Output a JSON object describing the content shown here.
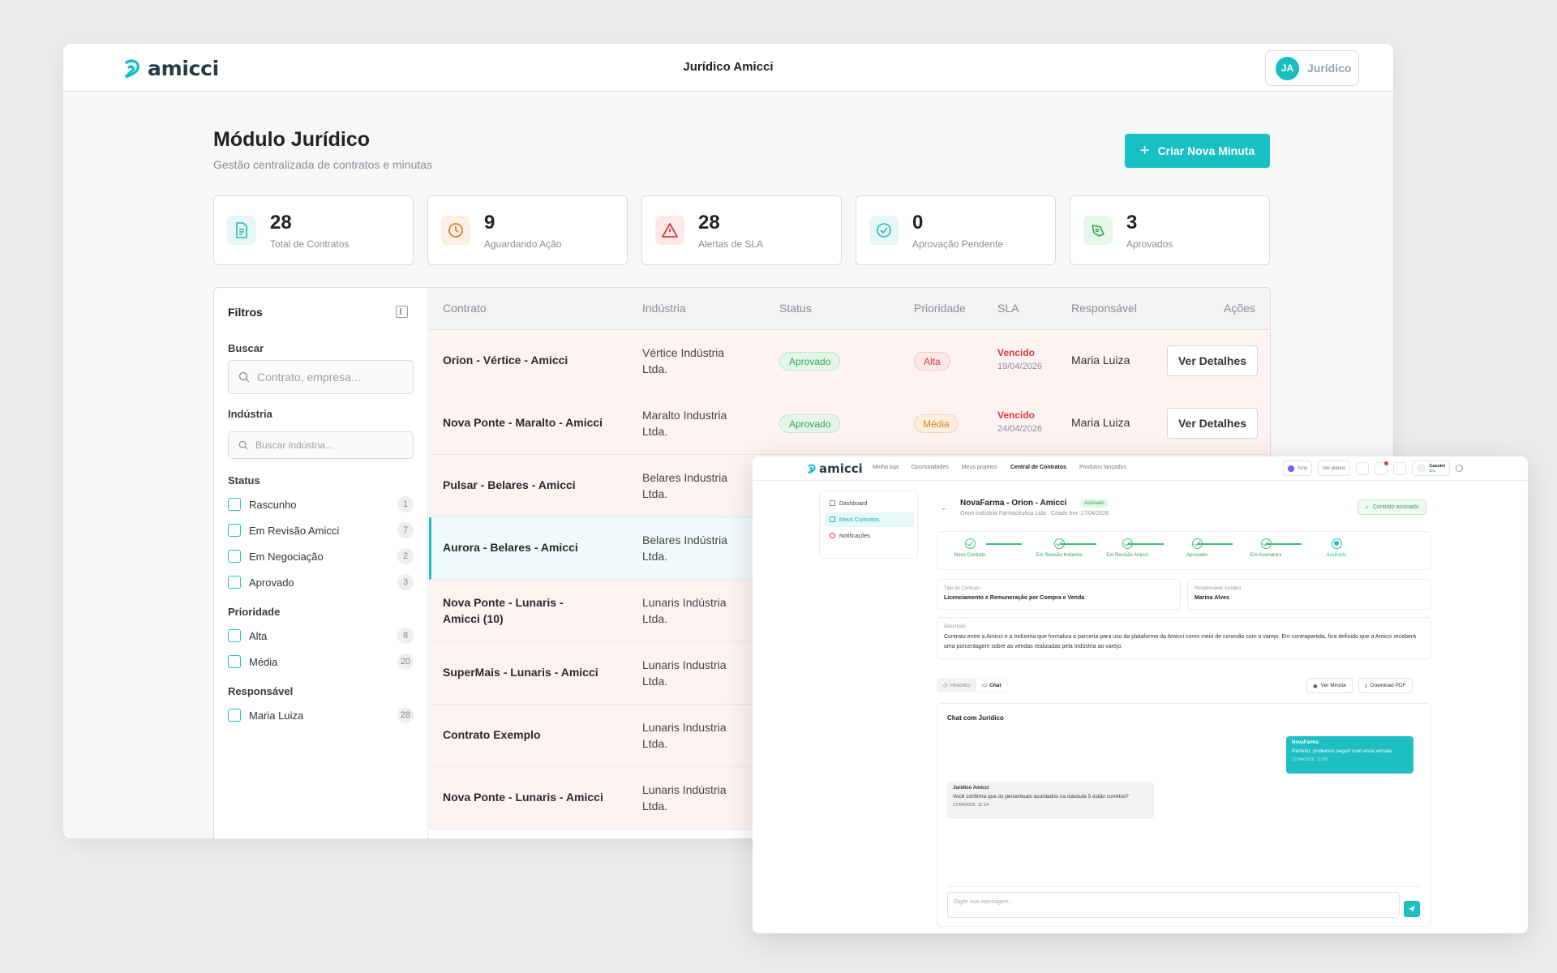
{
  "app": {
    "logo_text": "amicci",
    "window_title": "Jurídico Amicci",
    "user_initials": "JA",
    "user_name": "Jurídico",
    "accent": "#17c0c3"
  },
  "page": {
    "title": "Módulo Jurídico",
    "subtitle": "Gestão centralizada de contratos e minutas",
    "new_button": "Criar Nova Minuta"
  },
  "stats": [
    {
      "value": "28",
      "label": "Total de Contratos",
      "icon": "document-icon"
    },
    {
      "value": "9",
      "label": "Aguardando Ação",
      "icon": "clock-icon"
    },
    {
      "value": "28",
      "label": "Alertas de SLA",
      "icon": "warning-icon"
    },
    {
      "value": "0",
      "label": "Aprovação Pendente",
      "icon": "check-circle-icon"
    },
    {
      "value": "3",
      "label": "Aprovados",
      "icon": "pen-icon"
    }
  ],
  "filters": {
    "title": "Filtros",
    "search_label": "Buscar",
    "search_placeholder": "Contrato, empresa...",
    "industry_label": "Indústria",
    "industry_placeholder": "Buscar indústria...",
    "status_label": "Status",
    "status_items": [
      {
        "label": "Rascunho",
        "count": "1"
      },
      {
        "label": "Em Revisão Amicci",
        "count": "7"
      },
      {
        "label": "Em Negociação",
        "count": "2"
      },
      {
        "label": "Aprovado",
        "count": "3"
      }
    ],
    "priority_label": "Prioridade",
    "priority_items": [
      {
        "label": "Alta",
        "count": "8"
      },
      {
        "label": "Média",
        "count": "20"
      }
    ],
    "responsible_label": "Responsável",
    "responsible_items": [
      {
        "label": "Maria Luiza",
        "count": "28"
      }
    ]
  },
  "table": {
    "headers": [
      "Contrato",
      "Indústria",
      "Status",
      "Prioridade",
      "SLA",
      "Responsável",
      "Ações"
    ],
    "rows": [
      {
        "contract": "Orion - Vértice - Amicci",
        "industry": "Vértice Indústria Ltda.",
        "status": "Aprovado",
        "priority": "Alta",
        "sla": "Vencido",
        "sla_date": "19/04/2026",
        "responsible": "Maria Luiza",
        "action": "Ver Detalhes"
      },
      {
        "contract": "Nova Ponte - Maralto - Amicci",
        "industry": "Maralto Industria Ltda.",
        "status": "Aprovado",
        "priority": "Média",
        "sla": "Vencido",
        "sla_date": "24/04/2026",
        "responsible": "Maria Luiza",
        "action": "Ver Detalhes"
      },
      {
        "contract": "Pulsar - Belares - Amicci",
        "industry": "Belares Industria Ltda."
      },
      {
        "contract": "Aurora - Belares - Amicci",
        "industry": "Belares Indústria Ltda."
      },
      {
        "contract": "Nova Ponte - Lunaris - Amicci (10)",
        "industry": "Lunaris Indústria Ltda."
      },
      {
        "contract": "SuperMais - Lunaris - Amicci",
        "industry": "Lunaris Industria Ltda."
      },
      {
        "contract": "Contrato Exemplo",
        "industry": "Lunaris Industria Ltda."
      },
      {
        "contract": "Nova Ponte - Lunaris - Amicci",
        "industry": "Lunaris Indústria Ltda."
      }
    ]
  },
  "detail": {
    "nav": [
      "Minha loja",
      "Oportunidades",
      "Meus projetos",
      "Central de Contratos",
      "Produtos lançados"
    ],
    "nav_active": "Central de Contratos",
    "chips": [
      "Amy",
      "Ver planos"
    ],
    "user_short": "Cassini",
    "user_sub": "Bitu",
    "side_items": [
      "Dashboard",
      "Meus Contratos",
      "Notificações"
    ],
    "title": "NovaFarma - Orion - Amicci",
    "tag": "Assinado",
    "sub": "Orion Indústria Farmacêutica Ltda · Criado em: 17/04/2026",
    "signed_label": "Contrato assinado",
    "steps": [
      "Novo Contrato",
      "Em Revisão Indústria",
      "Em Revisão Amicci",
      "Aprovado",
      "Em Assinatura",
      "Assinado"
    ],
    "type_label": "Tipo de Contrato",
    "type_value": "Licenciamento e Remuneração por Compra e Venda",
    "resp_label": "Responsável Jurídico",
    "resp_value": "Marina Alves",
    "desc_label": "Descrição",
    "desc_value": "Contrato entre a Amicci e a Indústria que formaliza a parceria para uso da plataforma da Amicci como meio de conexão com o varejo. Em contrapartida, fica definido que a Amicci receberá uma porcentagem sobre as vendas realizadas pela Indústria ao varejo.",
    "tab_history": "Histórico",
    "tab_chat": "Chat",
    "btn_view": "Ver Minuta",
    "btn_download": "Download PDF",
    "chat_title": "Chat com Jurídico",
    "msg_me_name": "NovaFarma",
    "msg_me_text": "Perfeito, podemos seguir com essa versão.",
    "msg_me_date": "17/04/2026, 11:59",
    "msg_other_name": "Jurídico Amicci",
    "msg_other_text": "Você confirma que os percentuais acordados na cláusula 5 estão corretos?",
    "msg_other_date": "17/04/2026, 11:14",
    "input_placeholder": "Digite sua mensagem..."
  }
}
